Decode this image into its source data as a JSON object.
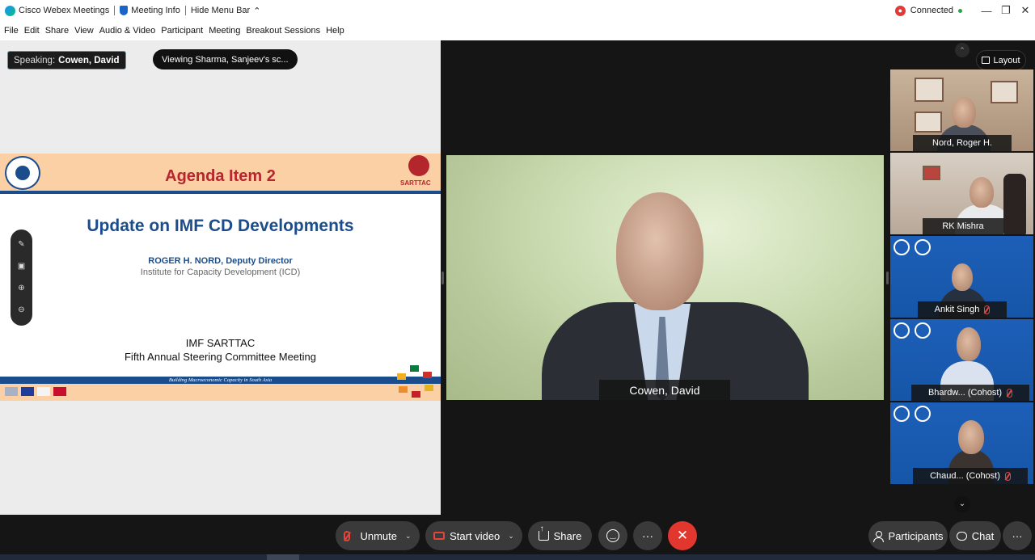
{
  "titlebar": {
    "app_name": "Cisco Webex Meetings",
    "meeting_info": "Meeting Info",
    "hide_menu": "Hide Menu Bar",
    "status": "Connected"
  },
  "menu": [
    "File",
    "Edit",
    "Share",
    "View",
    "Audio & Video",
    "Participant",
    "Meeting",
    "Breakout Sessions",
    "Help"
  ],
  "share": {
    "speaking_label": "Speaking:",
    "speaking_name": "Cowen, David",
    "viewing": "Viewing Sharma, Sanjeev's sc..."
  },
  "slide": {
    "heading": "Agenda Item 2",
    "sarttac_logo_text": "SARTTAC",
    "title": "Update on IMF CD Developments",
    "author": "ROGER H. NORD, Deputy Director",
    "institute": "Institute for Capacity Development (ICD)",
    "org": "IMF SARTTAC",
    "meeting": "Fifth Annual Steering Committee Meeting",
    "tagline": "Building Macroeconomic Capacity in South Asia"
  },
  "main_video": {
    "name": "Cowen, David"
  },
  "layout_label": "Layout",
  "participants": [
    {
      "name": "Nord, Roger H.",
      "muted": false
    },
    {
      "name": "RK Mishra",
      "muted": false
    },
    {
      "name": "Ankit Singh",
      "muted": true
    },
    {
      "name": "Bhardw...  (Cohost)",
      "muted": true
    },
    {
      "name": "Chaud...  (Cohost)",
      "muted": true
    }
  ],
  "controls": {
    "unmute": "Unmute",
    "start_video": "Start video",
    "share": "Share",
    "more": "···",
    "end": "✕",
    "participants": "Participants",
    "chat": "Chat",
    "overflow": "···"
  },
  "colors": {
    "accent_red": "#e2372e",
    "slide_blue": "#1b4d8c",
    "slide_red": "#b7252e",
    "slide_band": "#fbd0a4"
  }
}
